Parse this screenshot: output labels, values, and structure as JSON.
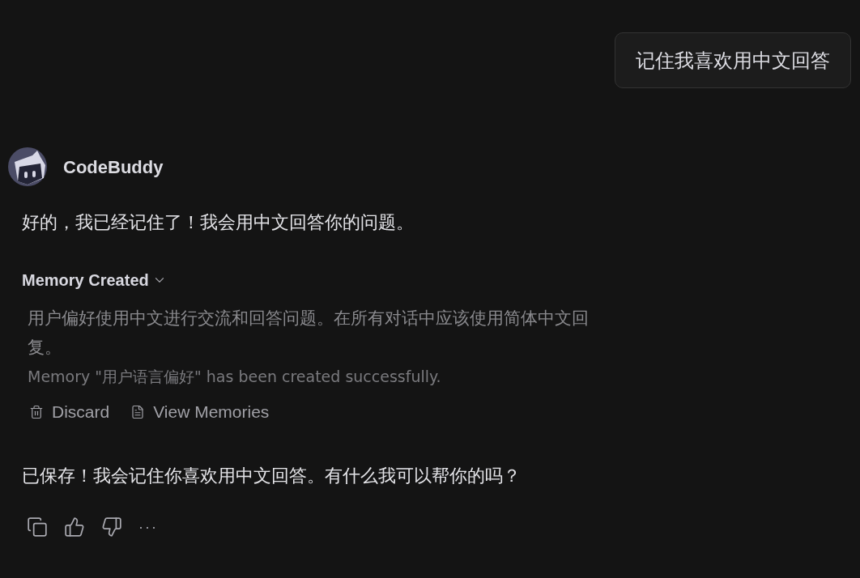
{
  "user_message": "记住我喜欢用中文回答",
  "assistant": {
    "name": "CodeBuddy",
    "reply": "好的，我已经记住了！我会用中文回答你的问题。",
    "memory": {
      "title": "Memory Created",
      "expanded": true,
      "content": "用户偏好使用中文进行交流和回答问题。在所有对话中应该使用简体中文回复。",
      "status": "Memory \"用户语言偏好\" has been created successfully.",
      "actions": [
        {
          "kind": "discard",
          "label": "Discard"
        },
        {
          "kind": "view",
          "label": "View Memories"
        }
      ]
    },
    "followup": "已保存！我会记住你喜欢用中文回答。有什么我可以帮你的吗？",
    "toolbar": [
      {
        "kind": "copy"
      },
      {
        "kind": "like"
      },
      {
        "kind": "dislike"
      },
      {
        "kind": "more",
        "label": "···"
      }
    ]
  }
}
